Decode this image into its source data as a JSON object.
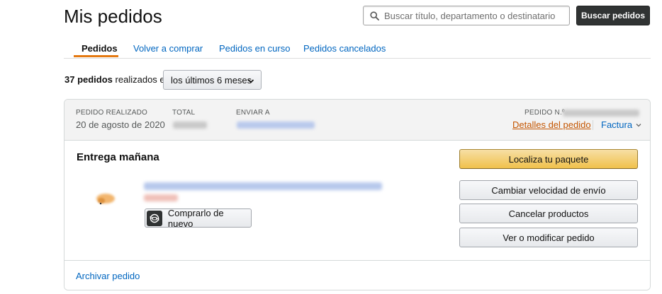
{
  "page": {
    "title": "Mis pedidos"
  },
  "search": {
    "placeholder": "Buscar título, departamento o destinatario",
    "button_label": "Buscar pedidos"
  },
  "tabs": [
    {
      "label": "Pedidos",
      "active": true
    },
    {
      "label": "Volver a comprar",
      "active": false
    },
    {
      "label": "Pedidos en curso",
      "active": false
    },
    {
      "label": "Pedidos cancelados",
      "active": false
    }
  ],
  "summary": {
    "count_text": "37 pedidos",
    "suffix": "realizados en",
    "period": "los últimos 6 meses"
  },
  "order": {
    "placed_label": "PEDIDO REALIZADO",
    "placed_date": "20 de agosto de 2020",
    "total_label": "TOTAL",
    "ship_to_label": "ENVIAR A",
    "order_number_label": "PEDIDO N.º",
    "details_link": "Detalles del pedido",
    "invoice_link": "Factura",
    "delivery_status": "Entrega mañana",
    "buy_again_label": "Comprarlo de nuevo",
    "actions": {
      "track": "Localiza tu paquete",
      "change_speed": "Cambiar velocidad de envío",
      "cancel": "Cancelar productos",
      "view_modify": "Ver o modificar pedido"
    },
    "archive_link": "Archivar pedido"
  },
  "colors": {
    "accent_orange": "#e47911",
    "link_blue": "#0066c0",
    "primary_button": "#f0c14b",
    "dark_button": "#303333"
  },
  "icons": [
    "search-icon",
    "chevron-down-icon",
    "buy-again-icon",
    "product-thumbnail"
  ]
}
